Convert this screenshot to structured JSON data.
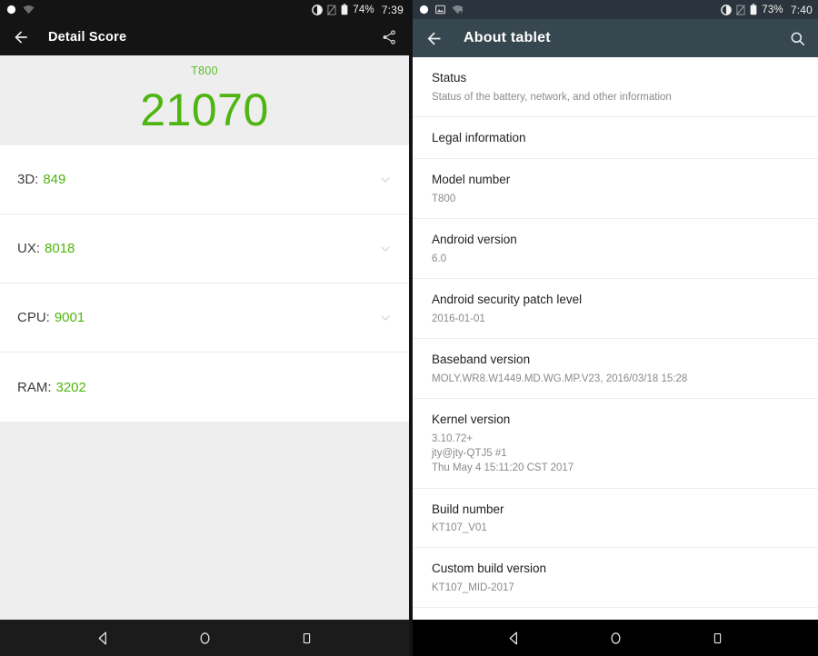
{
  "left_panel": {
    "status_bar": {
      "icons_left": [
        "circle-notification-icon",
        "wifi-weak-icon"
      ],
      "icons_right": [
        "brightness-contrast-icon",
        "sim-card-off-icon",
        "battery-icon"
      ],
      "battery": "74%",
      "time": "7:39"
    },
    "action_bar": {
      "back_icon": "arrow-back-icon",
      "title": "Detail Score",
      "share_icon": "share-icon"
    },
    "hero": {
      "model": "T800",
      "score": "21070"
    },
    "scores": [
      {
        "label": "3D:",
        "value": "849",
        "expandable": true
      },
      {
        "label": "UX:",
        "value": "8018",
        "expandable": true
      },
      {
        "label": "CPU:",
        "value": "9001",
        "expandable": true
      },
      {
        "label": "RAM:",
        "value": "3202",
        "expandable": false
      }
    ],
    "nav_bar": [
      "back-nav-icon",
      "home-nav-icon",
      "recents-nav-icon"
    ]
  },
  "right_panel": {
    "status_bar": {
      "icons_left": [
        "circle-notification-icon",
        "screenshot-icon",
        "wifi-question-icon"
      ],
      "icons_right": [
        "brightness-contrast-icon",
        "sim-card-off-icon",
        "battery-icon"
      ],
      "battery": "73%",
      "time": "7:40"
    },
    "action_bar": {
      "back_icon": "arrow-back-icon",
      "title": "About tablet",
      "search_icon": "search-icon"
    },
    "settings": [
      {
        "title": "Status",
        "sub": "Status of the battery, network, and other information"
      },
      {
        "title": "Legal information",
        "sub": ""
      },
      {
        "title": "Model number",
        "sub": "T800"
      },
      {
        "title": "Android version",
        "sub": "6.0"
      },
      {
        "title": "Android security patch level",
        "sub": "2016-01-01"
      },
      {
        "title": "Baseband version",
        "sub": "MOLY.WR8.W1449.MD.WG.MP.V23, 2016/03/18 15:28"
      },
      {
        "title": "Kernel version",
        "sub": "3.10.72+\njty@jty-QTJ5 #1\nThu May 4 15:11:20 CST 2017"
      },
      {
        "title": "Build number",
        "sub": "KT107_V01"
      },
      {
        "title": "Custom build version",
        "sub": "KT107_MID-2017"
      }
    ],
    "nav_bar": [
      "back-nav-icon",
      "home-nav-icon",
      "recents-nav-icon"
    ]
  },
  "colors": {
    "accent_green": "#4fb510",
    "status_bar_left": "#141414",
    "status_bar_right": "#2b343c",
    "action_bar_left": "#141414",
    "action_bar_right": "#37474f",
    "page_background": "#efeeee"
  }
}
